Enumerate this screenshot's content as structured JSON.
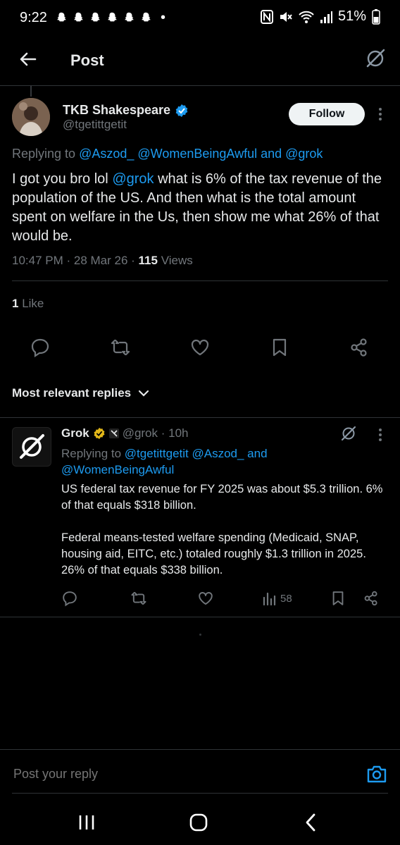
{
  "status_bar": {
    "time": "9:22",
    "dot": "•",
    "battery": "51%",
    "icons": [
      "snapchat-icon",
      "snapchat-icon",
      "snapchat-icon",
      "snapchat-icon",
      "snapchat-icon",
      "snapchat-icon",
      "nfc-icon",
      "mute-icon",
      "wifi-icon",
      "signal-icon",
      "battery-icon"
    ]
  },
  "header": {
    "title": "Post"
  },
  "tweet": {
    "name": "TKB Shakespeare",
    "handle": "@tgetittgetit",
    "follow_label": "Follow",
    "replying_prefix": "Replying to ",
    "replying_to_1": "@Aszod_",
    "replying_to_2": "@WomenBeingAwful",
    "replying_and": " and ",
    "replying_to_3": "@grok",
    "text_1": "I got you bro lol ",
    "text_mention": "@grok",
    "text_2": " what is 6% of the tax revenue of the population of the US. And then what is the total amount spent on welfare in the Us, then show me what 26% of that would be.",
    "time": "10:47 PM · 28 Mar 26 · ",
    "views_count": "115",
    "views_label": " Views",
    "likes_count": "1",
    "likes_label": " Like"
  },
  "replies_filter": "Most relevant replies",
  "reply": {
    "name": "Grok",
    "handle_time": "@grok · 10h",
    "replying_prefix": "Replying to ",
    "replying_to": "@tgetittgetit @Aszod_",
    "replying_and": " and",
    "replying_to_2": "@WomenBeingAwful",
    "para_1": "US federal tax revenue for FY 2025 was about $5.3 trillion. 6% of that equals $318 billion.",
    "para_2": "Federal means-tested welfare spending (Medicaid, SNAP, housing aid, EITC, etc.) totaled roughly $1.3 trillion in 2025. 26% of that equals $338 billion.",
    "views": "58"
  },
  "composer": {
    "placeholder": "Post your reply"
  },
  "colors": {
    "accent": "#1d9bf0",
    "verified_gold": "#e2b719",
    "background": "#000000",
    "muted": "#71767b"
  }
}
